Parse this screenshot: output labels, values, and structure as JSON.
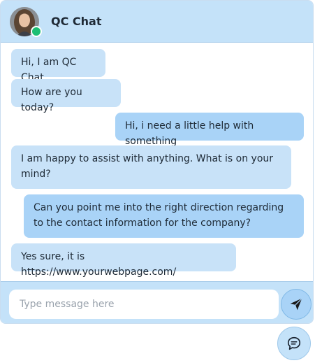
{
  "header": {
    "title": "QC Chat",
    "avatar_icon": "avatar-portrait",
    "status": "online",
    "status_color": "#1cbf74"
  },
  "messages": [
    {
      "sender": "bot",
      "text": "Hi, I am QC Chat"
    },
    {
      "sender": "bot",
      "text": "How are you today?"
    },
    {
      "sender": "user",
      "text": "Hi, i need a little help with something"
    },
    {
      "sender": "bot",
      "text": "I am happy to assist with anything. What is on your mind?"
    },
    {
      "sender": "user",
      "text": "Can you point me into the right direction regarding to the contact information for the company?"
    },
    {
      "sender": "bot",
      "text": "Yes sure, it is https://www.yourwebpage.com/"
    }
  ],
  "composer": {
    "placeholder": "Type message here",
    "value": "",
    "send_icon": "send-icon"
  },
  "launcher": {
    "icon": "chat-bubble-icon"
  },
  "colors": {
    "header_bg": "#c4e2f9",
    "bot_bubble": "#c8e2f8",
    "user_bubble": "#a9d3f7"
  }
}
